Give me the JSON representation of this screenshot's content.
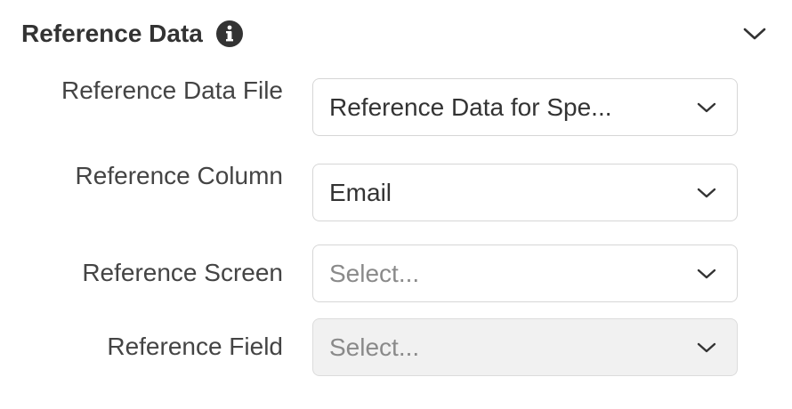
{
  "section": {
    "title": "Reference Data",
    "info_icon": "info-icon",
    "collapse_icon": "chevron-down-icon"
  },
  "fields": [
    {
      "label": "Reference Data File",
      "value": "Reference Data for Spe...",
      "placeholder": "",
      "disabled": false
    },
    {
      "label": "Reference Column",
      "value": "Email",
      "placeholder": "",
      "disabled": false
    },
    {
      "label": "Reference Screen",
      "value": "",
      "placeholder": "Select...",
      "disabled": false
    },
    {
      "label": "Reference Field",
      "value": "",
      "placeholder": "Select...",
      "disabled": true
    }
  ],
  "colors": {
    "text": "#333333",
    "border": "#d6d6d6",
    "placeholder": "#8a8a8a",
    "disabled_bg": "#f1f1f1"
  }
}
